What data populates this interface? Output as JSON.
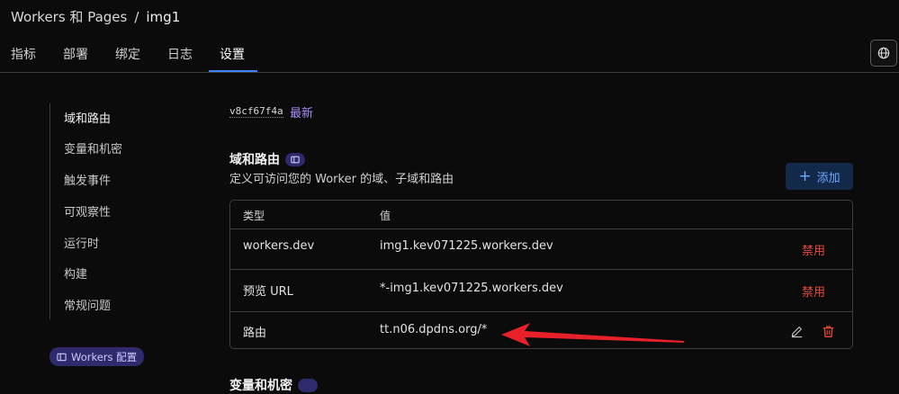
{
  "breadcrumb": {
    "parent": "Workers 和 Pages",
    "separator": "/",
    "current": "img1"
  },
  "tabs": [
    {
      "label": "指标"
    },
    {
      "label": "部署"
    },
    {
      "label": "绑定"
    },
    {
      "label": "日志"
    },
    {
      "label": "设置",
      "active": true
    }
  ],
  "sidebar": {
    "items": [
      {
        "label": "域和路由",
        "active": true
      },
      {
        "label": "变量和机密"
      },
      {
        "label": "触发事件"
      },
      {
        "label": "可观察性"
      },
      {
        "label": "运行时"
      },
      {
        "label": "构建"
      },
      {
        "label": "常规问题"
      }
    ],
    "config_badge": "Workers 配置"
  },
  "version": {
    "id": "v8cf67f4a",
    "tag": "最新"
  },
  "domains_section": {
    "title": "域和路由",
    "description": "定义可访问您的 Worker 的域、子域和路由",
    "add_button": "添加",
    "columns": {
      "type": "类型",
      "value": "值"
    },
    "rows": [
      {
        "type": "workers.dev",
        "value": "img1.kev071225.workers.dev",
        "action": "禁用"
      },
      {
        "type": "预览 URL",
        "value": "*-img1.kev071225.workers.dev",
        "action": "禁用"
      },
      {
        "type": "路由",
        "value": "tt.n06.dpdns.org/*",
        "action": ""
      }
    ]
  },
  "next_section": {
    "title": "变量和机密"
  },
  "colors": {
    "accent": "#3b82f6",
    "danger": "#e5483b",
    "link": "#a78bfa",
    "annotation": "#e8202a"
  }
}
